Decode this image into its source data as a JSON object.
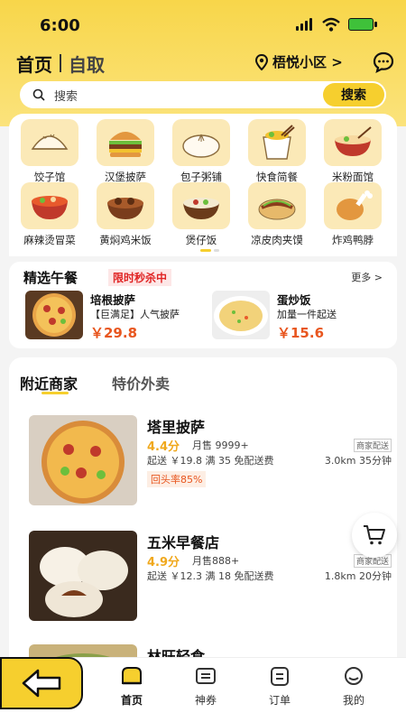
{
  "status_bar": {
    "time": "6:00"
  },
  "header": {
    "tab_home": "首页",
    "tab_pickup": "自取",
    "location": "梧悦小区 >"
  },
  "search": {
    "placeholder": "搜索",
    "button_label": "搜索"
  },
  "categories": [
    {
      "label": "饺子馆",
      "icon": "dumpling-icon"
    },
    {
      "label": "汉堡披萨",
      "icon": "burger-icon"
    },
    {
      "label": "包子粥铺",
      "icon": "bun-icon"
    },
    {
      "label": "快食简餐",
      "icon": "takeout-box-icon"
    },
    {
      "label": "米粉面馆",
      "icon": "noodle-bowl-icon"
    },
    {
      "label": "麻辣烫冒菜",
      "icon": "spicy-pot-icon"
    },
    {
      "label": "黄焖鸡米饭",
      "icon": "braised-chicken-icon"
    },
    {
      "label": "煲仔饭",
      "icon": "clay-pot-rice-icon"
    },
    {
      "label": "凉皮肉夹馍",
      "icon": "roujiamo-icon"
    },
    {
      "label": "炸鸡鸭脖",
      "icon": "fried-chicken-icon"
    }
  ],
  "lunch": {
    "title": "精选午餐",
    "promo": "限时秒杀中",
    "more": "更多 >",
    "deals": [
      {
        "name": "培根披萨",
        "desc": "【巨满足】人气披萨",
        "price": "￥29.8"
      },
      {
        "name": "蛋炒饭",
        "desc": "加量一件起送",
        "price": "￥15.6"
      }
    ]
  },
  "nearby": {
    "tab_active": "附近商家",
    "tab_inactive": "特价外卖",
    "shops": [
      {
        "name": "塔里披萨",
        "rating": "4.4分",
        "sales": "月售 9999+",
        "fee": "起送 ￥19.8 满 35 免配送费",
        "tag": "商家配送",
        "distance": "3.0km  35分钟",
        "return_rate": "回头率85%"
      },
      {
        "name": "五米早餐店",
        "rating": "4.9分",
        "sales": "月售888+",
        "fee": "起送 ￥12.3 满 18 免配送费",
        "tag": "商家配送",
        "distance": "1.8km  20分钟"
      },
      {
        "name": "林旺轻食"
      }
    ]
  },
  "tabbar": {
    "items": [
      {
        "label": "首页",
        "icon": "home-icon"
      },
      {
        "label": "神券",
        "icon": "coupon-icon"
      },
      {
        "label": "订单",
        "icon": "order-icon"
      },
      {
        "label": "我的",
        "icon": "profile-icon"
      }
    ]
  },
  "colors": {
    "accent": "#f6cf2e",
    "price": "#e8561f",
    "rating": "#f0a81c",
    "promo": "#e02424"
  }
}
